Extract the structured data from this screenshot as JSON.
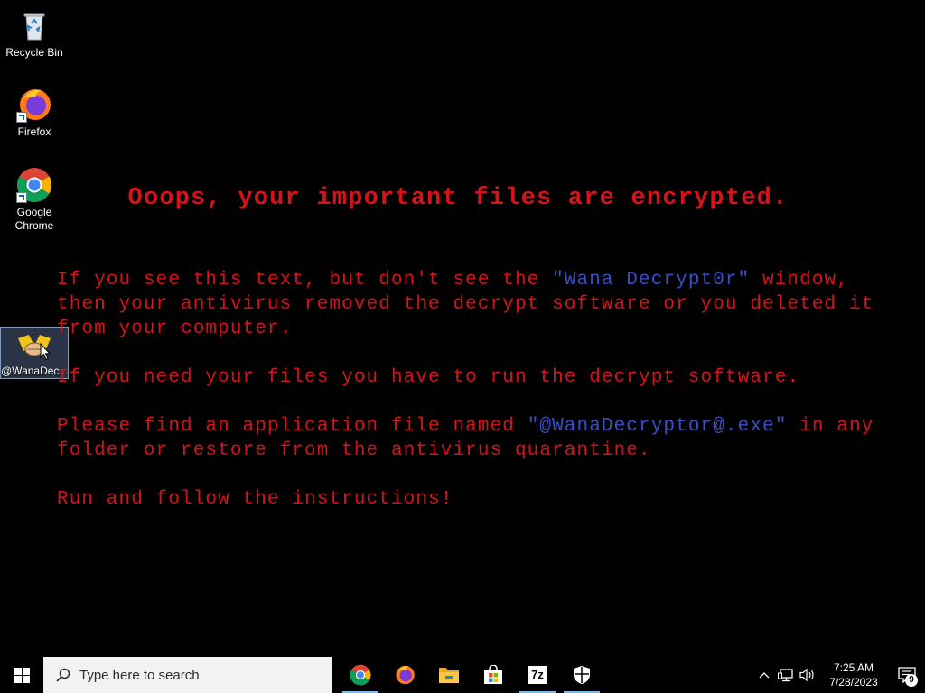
{
  "desktop": {
    "icons": [
      {
        "label": "Recycle Bin"
      },
      {
        "label": "Firefox"
      },
      {
        "label": "Google Chrome"
      },
      {
        "label": "@WanaDec..."
      }
    ]
  },
  "wallpaper": {
    "title": "Ooops, your important files are encrypted.",
    "p1_a": "If you see this text, but don't see the ",
    "p1_highlight": "\"Wana Decrypt0r\"",
    "p1_b": " window, then your antivirus removed the decrypt software or you deleted it from your computer.",
    "p2": "If you need your files you have to run the decrypt software.",
    "p3_a": "Please find an application file named ",
    "p3_highlight": "\"@WanaDecryptor@.exe\"",
    "p3_b": " in any folder or restore from the antivirus quarantine.",
    "p4": "Run and follow the instructions!",
    "colors": {
      "text": "#d4141a",
      "highlight": "#3a4fc8"
    }
  },
  "taskbar": {
    "search_placeholder": "Type here to search",
    "apps": [
      "chrome-icon",
      "firefox-icon",
      "file-explorer-icon",
      "store-icon",
      "7zip-icon",
      "security-icon"
    ],
    "sevenzip_label": "7z",
    "clock": {
      "time": "7:25 AM",
      "date": "7/28/2023"
    },
    "notification_count": "9"
  }
}
